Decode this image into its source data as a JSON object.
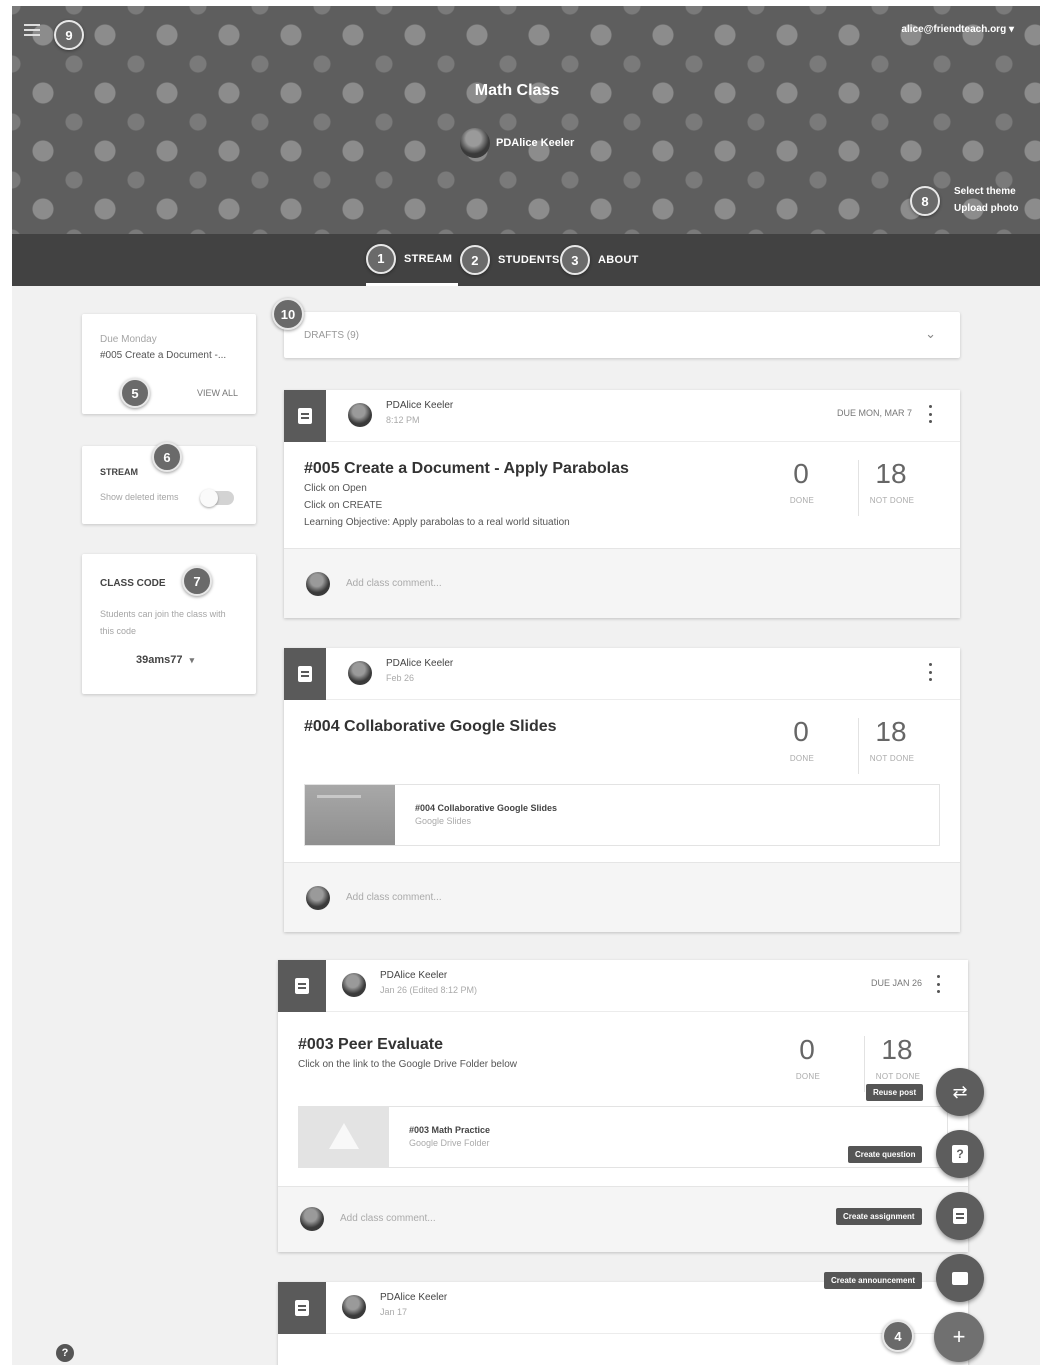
{
  "header": {
    "account": "alice@friendteach.org",
    "class_title": "Math Class",
    "teacher": "PDAlice Keeler",
    "theme": {
      "select": "Select theme",
      "upload": "Upload photo"
    }
  },
  "tabs": [
    {
      "num": "1",
      "label": "STREAM"
    },
    {
      "num": "2",
      "label": "STUDENTS"
    },
    {
      "num": "3",
      "label": "ABOUT"
    }
  ],
  "callouts": {
    "add": "4",
    "upcoming": "5",
    "stream": "6",
    "code": "7",
    "theme": "8",
    "menu": "9",
    "drafts": "10"
  },
  "sidebar": {
    "upcoming": {
      "due": "Due Monday",
      "item": "#005 Create a Document -...",
      "view_all": "VIEW ALL"
    },
    "stream": {
      "heading": "STREAM",
      "toggle_label": "Show deleted items"
    },
    "class_code": {
      "heading": "CLASS CODE",
      "desc": "Students can join the class with this code",
      "code": "39ams77"
    }
  },
  "drafts": {
    "label": "DRAFTS (9)"
  },
  "posts": [
    {
      "author": "PDAlice Keeler",
      "time": "8:12 PM",
      "due": "DUE MON, MAR 7",
      "title": "#005 Create a Document - Apply Parabolas",
      "desc": [
        "Click on Open",
        "Click on CREATE",
        "Learning Objective: Apply parabolas to a real world situation"
      ],
      "done": "0",
      "done_label": "DONE",
      "not_done": "18",
      "not_done_label": "NOT DONE",
      "comment": "Add class comment..."
    },
    {
      "author": "PDAlice Keeler",
      "time": "Feb 26",
      "title": "#004 Collaborative Google Slides",
      "done": "0",
      "done_label": "DONE",
      "not_done": "18",
      "not_done_label": "NOT DONE",
      "attachment": {
        "title": "#004 Collaborative Google Slides",
        "type": "Google Slides"
      },
      "comment": "Add class comment..."
    },
    {
      "author": "PDAlice Keeler",
      "time": "Jan 26 (Edited 8:12 PM)",
      "due": "DUE JAN 26",
      "title": "#003 Peer Evaluate",
      "desc": [
        "Click on the link to the Google Drive Folder below"
      ],
      "done": "0",
      "done_label": "DONE",
      "not_done": "18",
      "not_done_label": "NOT DONE",
      "attachment": {
        "title": "#003 Math Practice",
        "type": "Google Drive Folder"
      },
      "comment": "Add class comment..."
    },
    {
      "author": "PDAlice Keeler",
      "time": "Jan 17"
    }
  ],
  "fab_menu": {
    "reuse": "Reuse post",
    "question": "Create question",
    "assignment": "Create assignment",
    "announcement": "Create announcement",
    "add": "+"
  },
  "help": "?"
}
